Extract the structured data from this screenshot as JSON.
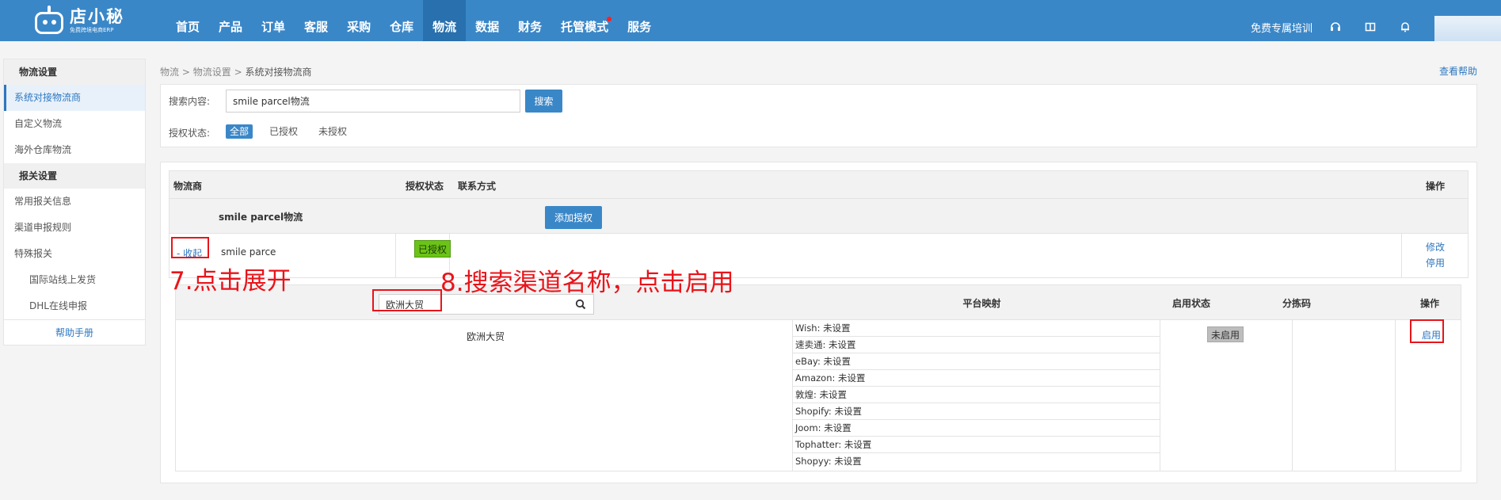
{
  "app": {
    "logo_text": "店小秘",
    "logo_sub": "免费跨境电商ERP"
  },
  "nav": [
    {
      "label": "首页"
    },
    {
      "label": "产品"
    },
    {
      "label": "订单"
    },
    {
      "label": "客服"
    },
    {
      "label": "采购"
    },
    {
      "label": "仓库"
    },
    {
      "label": "物流",
      "active": true
    },
    {
      "label": "数据"
    },
    {
      "label": "财务"
    },
    {
      "label": "托管模式",
      "dot": true
    },
    {
      "label": "服务"
    }
  ],
  "top_right": {
    "training": "免费专属培训"
  },
  "sidebar": {
    "group1": "物流设置",
    "group1_items": [
      "系统对接物流商",
      "自定义物流",
      "海外仓库物流"
    ],
    "group2": "报关设置",
    "group2_items": [
      "常用报关信息",
      "渠道申报规则",
      "特殊报关"
    ],
    "group2_sub_items": [
      "国际站线上发货",
      "DHL在线申报"
    ],
    "help": "帮助手册"
  },
  "breadcrumb": {
    "level1": "物流",
    "level2": "物流设置",
    "current": "系统对接物流商",
    "sep": ">"
  },
  "help_link": "查看帮助",
  "search": {
    "label": "搜索内容:",
    "value": "smile parcel物流",
    "button": "搜索",
    "auth_label": "授权状态:",
    "auth_options": [
      "全部",
      "已授权",
      "未授权"
    ]
  },
  "table": {
    "headers": {
      "provider": "物流商",
      "auth_status": "授权状态",
      "contact": "联系方式",
      "ops": "操作"
    },
    "group_name": "smile parcel物流",
    "add_auth": "添加授权",
    "provider_row": {
      "toggle": "- 收起",
      "name": "smile parce",
      "status": "已授权",
      "ops": [
        "修改",
        "停用"
      ]
    }
  },
  "channels": {
    "search_value": "欧洲大贸",
    "headers": {
      "mapping": "平台映射",
      "enable_status": "启用状态",
      "sort_code": "分拣码",
      "ops": "操作"
    },
    "row": {
      "name": "欧洲大贸",
      "mappings": [
        "Wish: 未设置",
        "速卖通: 未设置",
        "eBay: 未设置",
        "Amazon: 未设置",
        "敦煌: 未设置",
        "Shopify: 未设置",
        "Joom: 未设置",
        "Tophatter: 未设置",
        "Shopyy: 未设置"
      ],
      "status": "未启用",
      "action": "启用"
    }
  },
  "annotations": {
    "step7": "7.点击展开",
    "step8": "8.搜索渠道名称，点击启用",
    "color": "#e8141a"
  }
}
